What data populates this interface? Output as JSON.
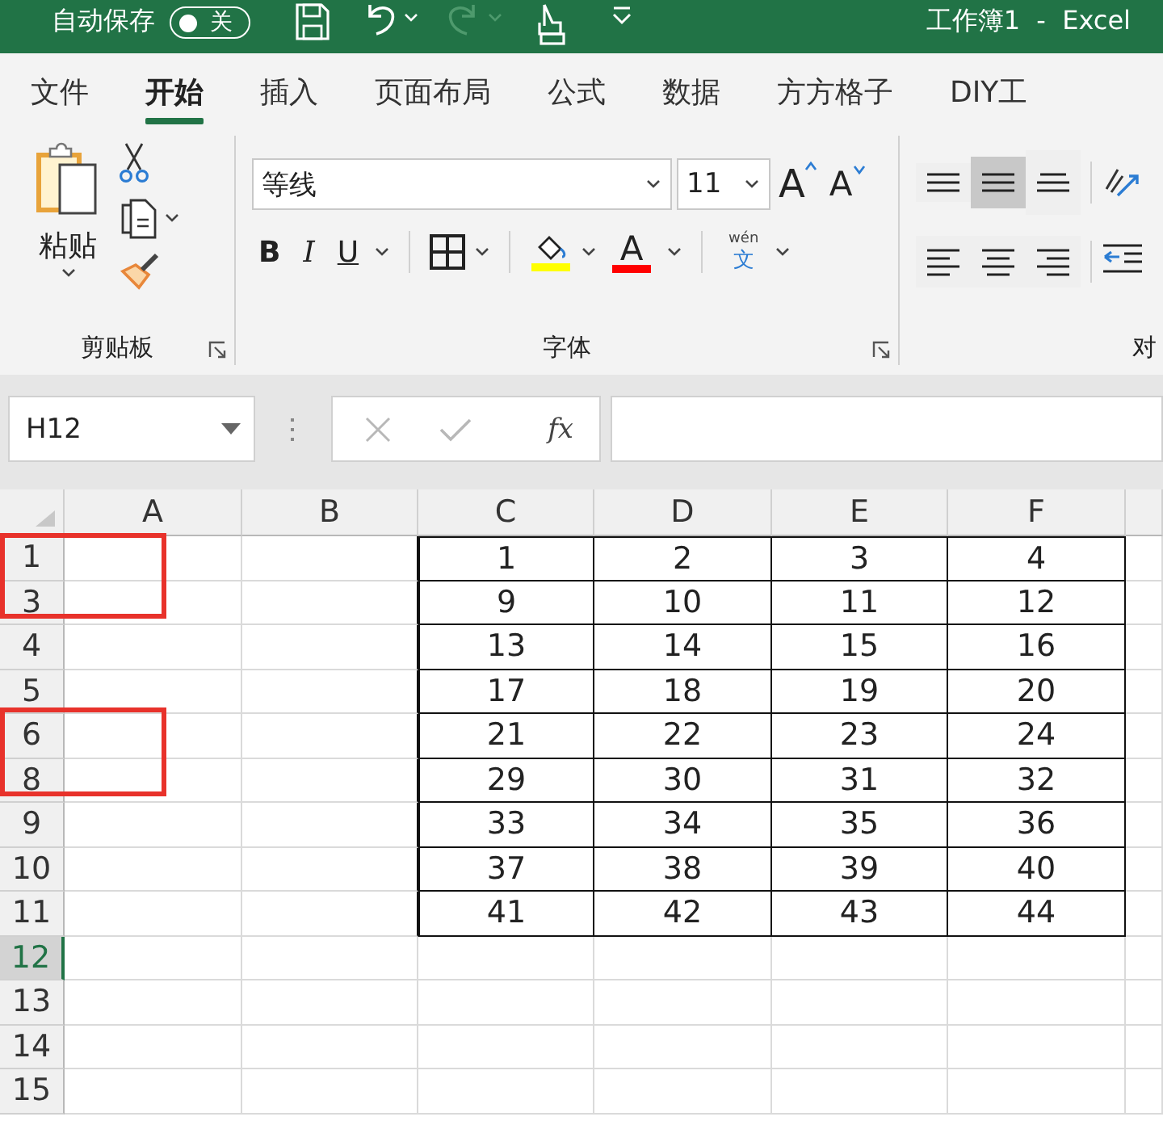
{
  "title_bar": {
    "autosave_label": "自动保存",
    "autosave_toggle": {
      "on": false,
      "label": "关"
    },
    "redo_disabled": true,
    "title": "工作簿1  -  Excel"
  },
  "menu_tabs": [
    {
      "label": "文件",
      "selected": false
    },
    {
      "label": "开始",
      "selected": true
    },
    {
      "label": "插入",
      "selected": false
    },
    {
      "label": "页面布局",
      "selected": false
    },
    {
      "label": "公式",
      "selected": false
    },
    {
      "label": "数据",
      "selected": false
    },
    {
      "label": "方方格子",
      "selected": false
    },
    {
      "label": "DIY工",
      "selected": false
    }
  ],
  "ribbon": {
    "clipboard": {
      "paste_label": "粘贴",
      "group_label": "剪贴板"
    },
    "font": {
      "font_name": "等线",
      "font_size": "11",
      "grow": "A",
      "shrink": "A",
      "bold": "B",
      "italic": "I",
      "underline": "U",
      "font_color_letter": "A",
      "phonetic_top": "wén",
      "phonetic_char": "文",
      "group_label": "字体"
    },
    "alignment": {
      "vertical": [
        {
          "kind": "top",
          "selected": false
        },
        {
          "kind": "middle",
          "selected": true
        },
        {
          "kind": "bottom",
          "selected": false
        }
      ],
      "horizontal": [
        {
          "kind": "left",
          "selected": false
        },
        {
          "kind": "center",
          "selected": false
        },
        {
          "kind": "right",
          "selected": false
        }
      ],
      "group_label": "对"
    }
  },
  "formula_bar": {
    "name_box": "H12",
    "cancel_disabled": true,
    "enter_disabled": true,
    "insert_function": "fx"
  },
  "sheet": {
    "columns": [
      "A",
      "B",
      "C",
      "D",
      "E",
      "F"
    ],
    "rows": [
      {
        "header": "1",
        "selected": false,
        "boxed": true,
        "values": [
          "1",
          "2",
          "3",
          "4"
        ]
      },
      {
        "header": "3",
        "selected": false,
        "boxed": true,
        "values": [
          "9",
          "10",
          "11",
          "12"
        ]
      },
      {
        "header": "4",
        "selected": false,
        "boxed": false,
        "values": [
          "13",
          "14",
          "15",
          "16"
        ]
      },
      {
        "header": "5",
        "selected": false,
        "boxed": false,
        "values": [
          "17",
          "18",
          "19",
          "20"
        ]
      },
      {
        "header": "6",
        "selected": false,
        "boxed": true,
        "values": [
          "21",
          "22",
          "23",
          "24"
        ]
      },
      {
        "header": "8",
        "selected": false,
        "boxed": true,
        "values": [
          "29",
          "30",
          "31",
          "32"
        ]
      },
      {
        "header": "9",
        "selected": false,
        "boxed": false,
        "values": [
          "33",
          "34",
          "35",
          "36"
        ]
      },
      {
        "header": "10",
        "selected": false,
        "boxed": false,
        "values": [
          "37",
          "38",
          "39",
          "40"
        ]
      },
      {
        "header": "11",
        "selected": false,
        "boxed": false,
        "values": [
          "41",
          "42",
          "43",
          "44"
        ]
      },
      {
        "header": "12",
        "selected": true,
        "boxed": false
      },
      {
        "header": "13",
        "selected": false,
        "boxed": false
      },
      {
        "header": "14",
        "selected": false,
        "boxed": false
      },
      {
        "header": "15",
        "selected": false,
        "boxed": false
      }
    ]
  }
}
